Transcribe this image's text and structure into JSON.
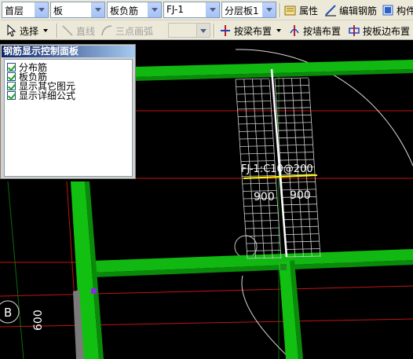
{
  "toolbar1": {
    "floor_combo": "首层",
    "category_combo": "板",
    "type_combo": "板负筋",
    "element_combo": "FJ-1",
    "layer_combo": "分层板1",
    "properties_label": "属性",
    "edit_rebar_label": "编辑钢筋",
    "component_label": "构件"
  },
  "toolbar2": {
    "select_label": "选择",
    "line_label": "直线",
    "arc_label": "三点画弧",
    "beam_layout_label": "按梁布置",
    "wall_layout_label": "按墙布置",
    "slab_edge_layout_label": "按板边布置"
  },
  "panel": {
    "title": "钢筋显示控制面板",
    "items": [
      {
        "label": "分布筋",
        "checked": true
      },
      {
        "label": "板负筋",
        "checked": true
      },
      {
        "label": "显示其它图元",
        "checked": true
      },
      {
        "label": "显示详细公式",
        "checked": true
      }
    ]
  },
  "drawing": {
    "rebar_label": "FJ-1:C10@200",
    "left_dim": "900",
    "right_dim": "900",
    "axis_label": "B",
    "axis_dim": "600"
  },
  "colors": {
    "beam": "#0fc00f",
    "rebar_mark": "#ffffff",
    "axis_line": "#d01010",
    "grid_line": "#1d6f1d",
    "background": "#000000",
    "selection_marker": "#ffff00"
  }
}
